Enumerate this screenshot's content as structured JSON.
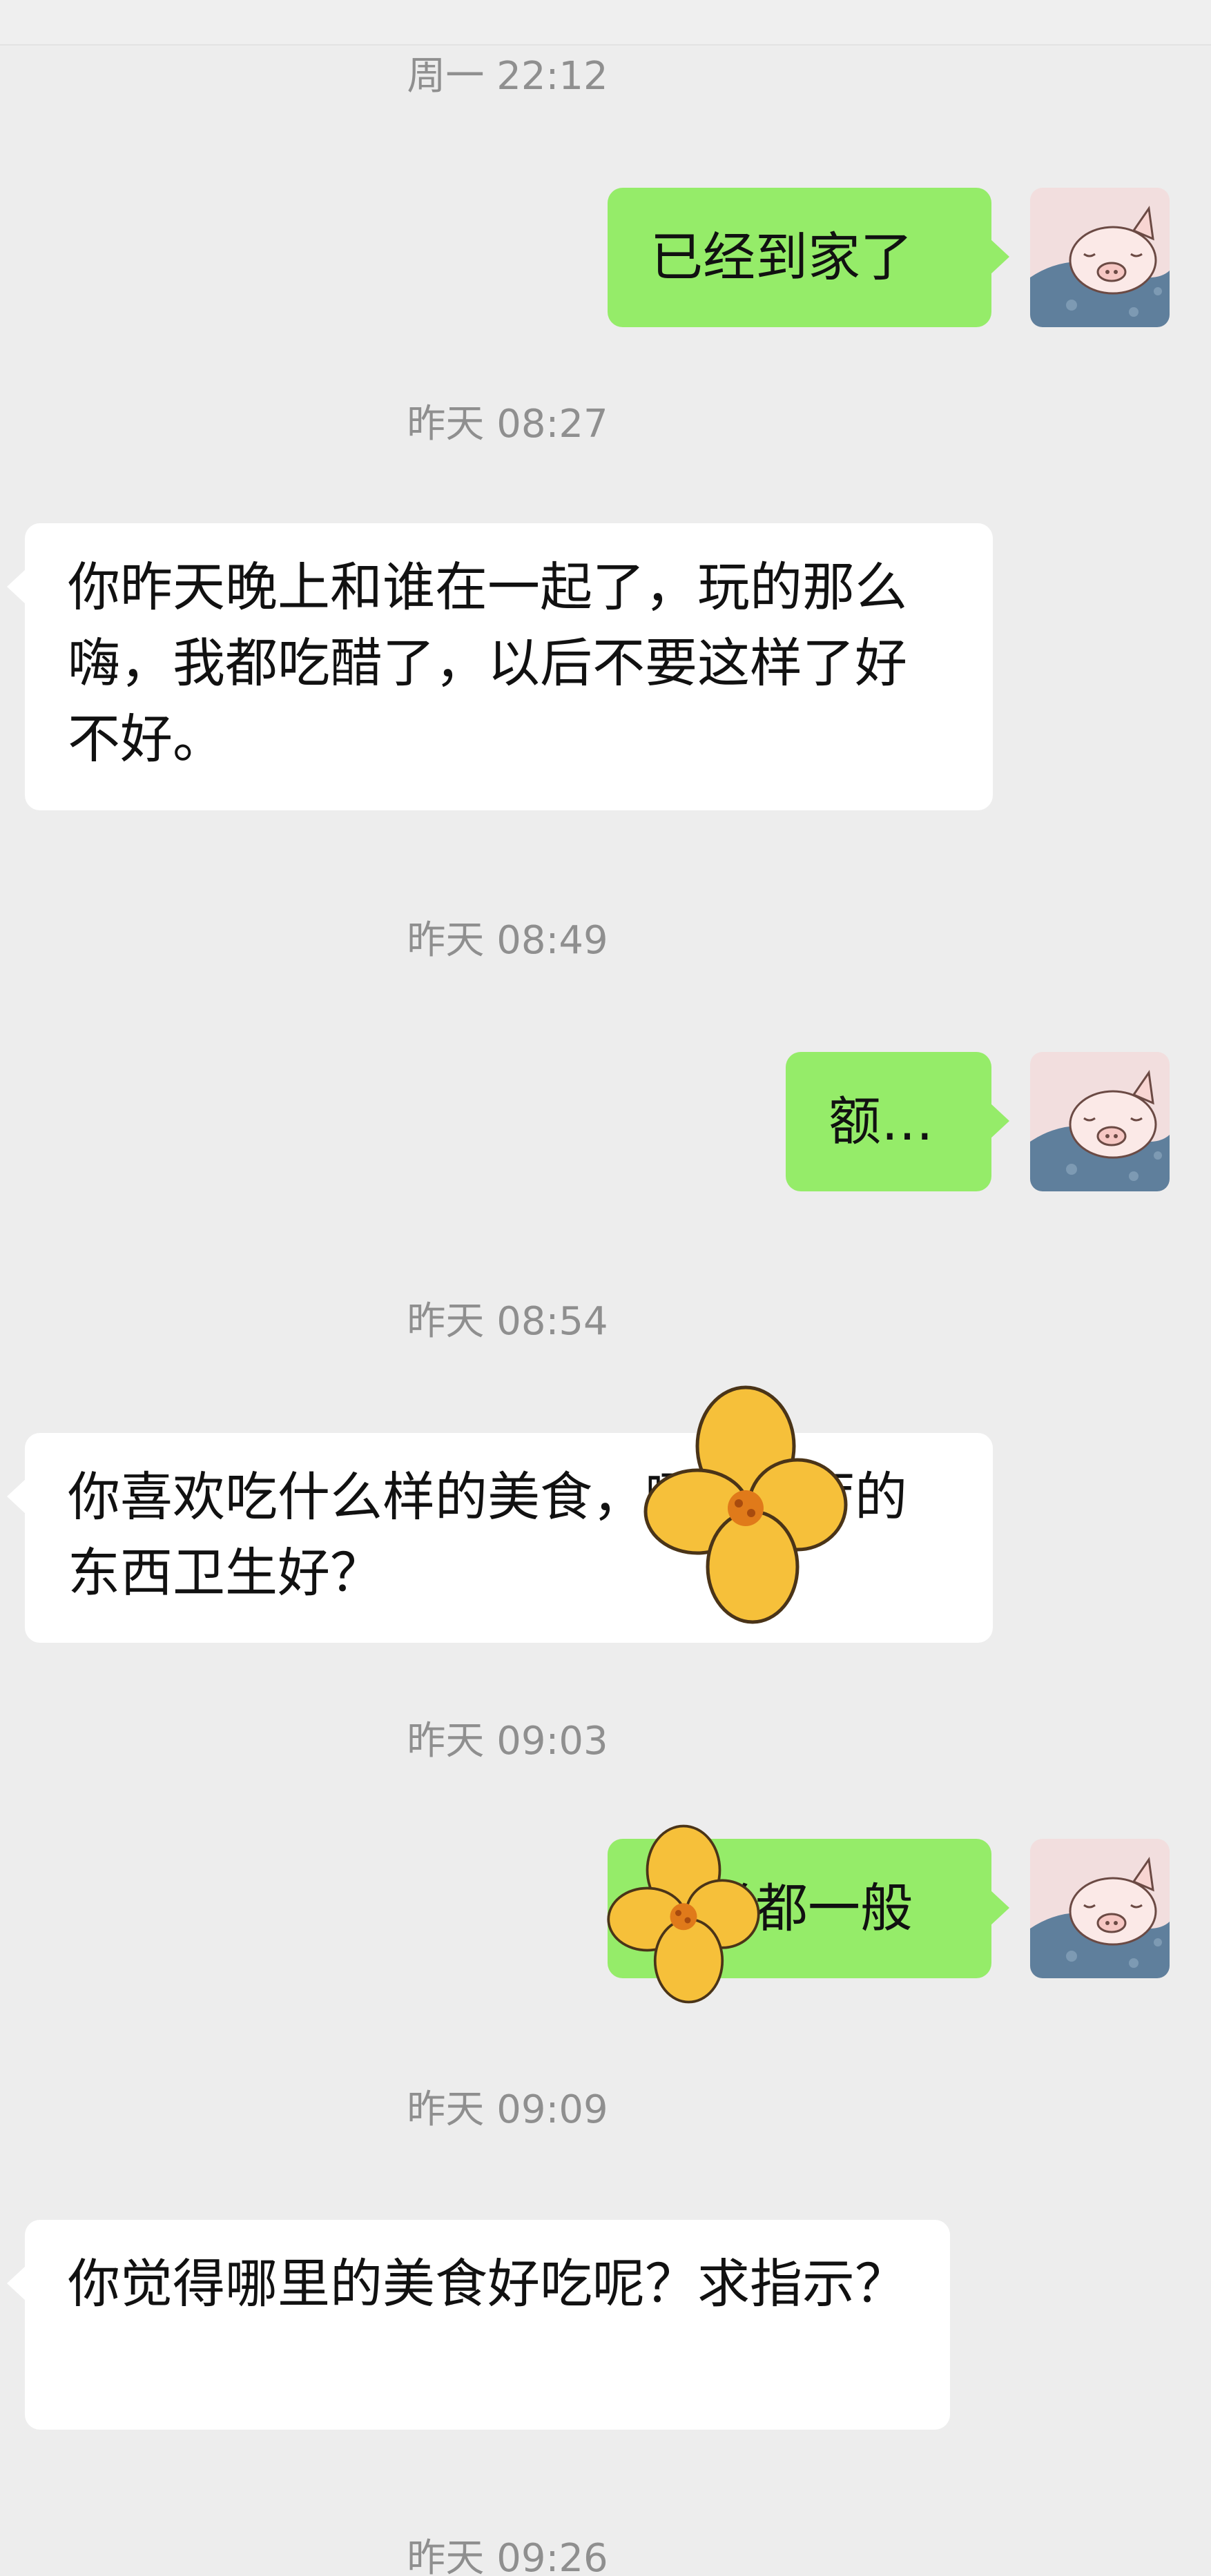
{
  "colors": {
    "background": "#ededed",
    "sent_bubble": "#95ec69",
    "received_bubble": "#ffffff",
    "timestamp": "#8f8f8f",
    "sticker_petal": "#f6c03a",
    "sticker_center": "#e07a1a"
  },
  "icons": {
    "avatar": "pig-sleeping-avatar",
    "sticker": "yellow-flower-sticker"
  },
  "messages": [
    {
      "timestamp": "周一 22:12",
      "side": "sent",
      "text": "已经到家了"
    },
    {
      "timestamp": "昨天 08:27",
      "side": "received",
      "text": "你昨天晚上和谁在一起了，玩的那么嗨，我都吃醋了，以后不要这样了好不好。"
    },
    {
      "timestamp": "昨天 08:49",
      "side": "sent",
      "text": "额…"
    },
    {
      "timestamp": "昨天 08:54",
      "side": "received",
      "text": "你喜欢吃什么样的美食，哪个餐厅的东西卫生好？"
    },
    {
      "timestamp": "昨天 09:03",
      "side": "sent",
      "text": "感觉都一般"
    },
    {
      "timestamp": "昨天 09:09",
      "side": "received",
      "text": "你觉得哪里的美食好吃呢？求指示？"
    },
    {
      "timestamp": "昨天 09:26",
      "side": "none",
      "text": ""
    }
  ]
}
